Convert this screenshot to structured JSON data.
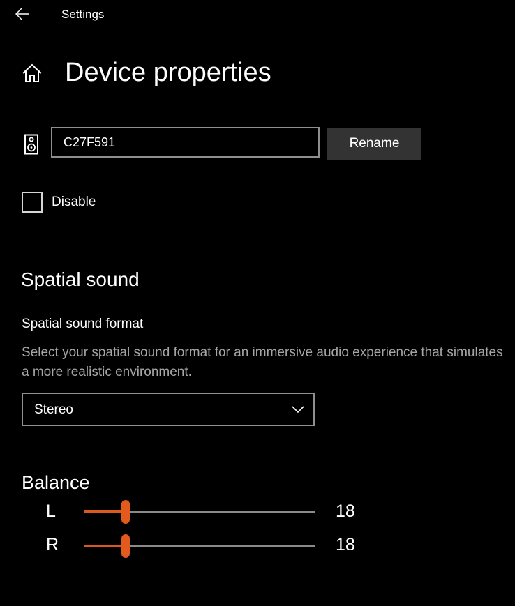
{
  "titlebar": {
    "title": "Settings",
    "back_icon": "back-arrow-icon"
  },
  "header": {
    "home_icon": "home-icon",
    "page_title": "Device properties"
  },
  "device": {
    "icon": "speaker-icon",
    "name_value": "C27F591",
    "rename_label": "Rename"
  },
  "disable": {
    "label": "Disable",
    "checked": false
  },
  "spatial_sound": {
    "section_title": "Spatial sound",
    "format_label": "Spatial sound format",
    "description": "Select your spatial sound format for an immersive audio experience that simulates a more realistic environment.",
    "selected_format": "Stereo",
    "chevron_icon": "chevron-down-icon"
  },
  "balance": {
    "title": "Balance",
    "channels": [
      {
        "label": "L",
        "value": "18",
        "level": 18
      },
      {
        "label": "R",
        "value": "18",
        "level": 18
      }
    ]
  },
  "colors": {
    "background": "#000000",
    "accent": "#e35a1e",
    "control_border": "#8e8e8e",
    "button_bg": "#333333",
    "secondary_text": "#a6a6a6"
  }
}
